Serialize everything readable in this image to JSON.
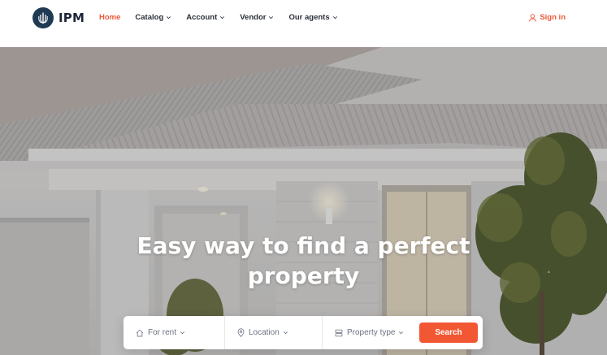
{
  "brand": {
    "name": "IPM",
    "logo_icon": "shield-logo-icon",
    "color": "#1f3a52"
  },
  "nav": {
    "items": [
      {
        "label": "Home",
        "active": true,
        "dropdown": false
      },
      {
        "label": "Catalog",
        "active": false,
        "dropdown": true
      },
      {
        "label": "Account",
        "active": false,
        "dropdown": true
      },
      {
        "label": "Vendor",
        "active": false,
        "dropdown": true
      },
      {
        "label": "Our agents",
        "active": false,
        "dropdown": true
      }
    ],
    "signin_label": "Sign in",
    "signin_icon": "user-icon"
  },
  "hero": {
    "title_line1": "Easy way to find a perfect",
    "title_line2": "property",
    "background": "house exterior photo"
  },
  "search": {
    "type_label": "For rent",
    "type_icon": "home-icon",
    "location_label": "Location",
    "location_icon": "map-pin-icon",
    "property_label": "Property type",
    "property_icon": "building-icon",
    "button_label": "Search"
  },
  "colors": {
    "accent": "#ec5a3c",
    "button": "#f25733",
    "text": "#2a2f3a"
  }
}
